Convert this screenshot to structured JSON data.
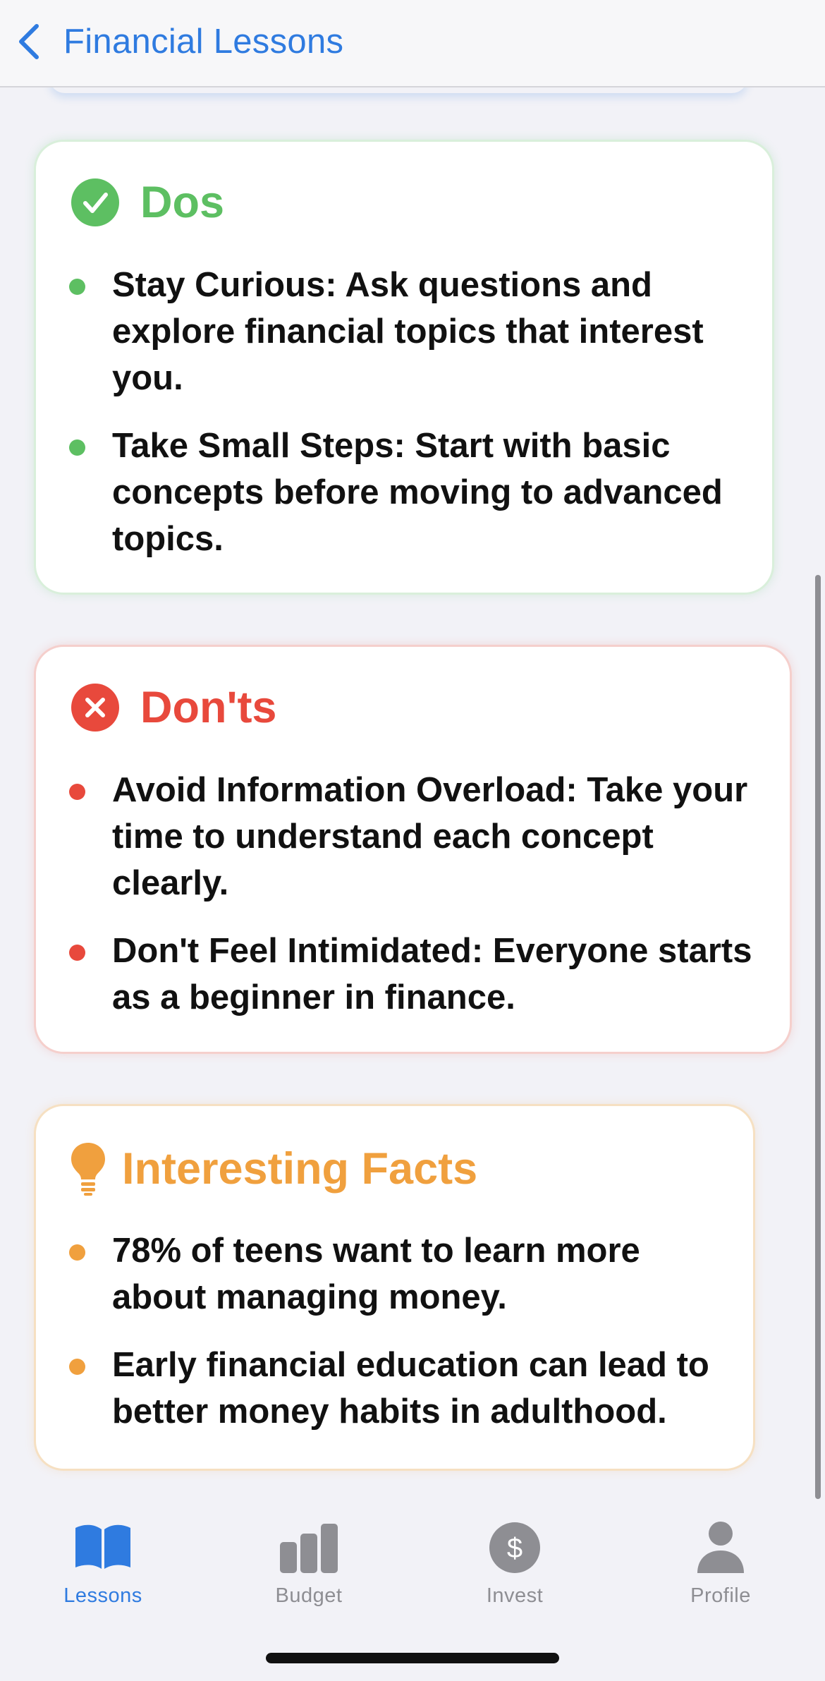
{
  "nav": {
    "title": "Financial Lessons",
    "back_icon": "chevron-left-icon"
  },
  "colors": {
    "accent": "#2f7be0",
    "dos": "#5dbf62",
    "donts": "#e8493c",
    "facts": "#f0a03e",
    "inactive_tab": "#8e8e93"
  },
  "sections": {
    "dos": {
      "title": "Dos",
      "icon": "checkmark-circle-icon",
      "items": [
        "Stay Curious: Ask questions and explore financial topics that interest you.",
        "Take Small Steps: Start with basic concepts before moving to advanced topics."
      ]
    },
    "donts": {
      "title": "Don'ts",
      "icon": "xmark-circle-icon",
      "items": [
        "Avoid Information Overload: Take your time to understand each concept clearly.",
        "Don't Feel Intimidated: Everyone starts as a beginner in finance."
      ]
    },
    "facts": {
      "title": "Interesting Facts",
      "icon": "lightbulb-icon",
      "items": [
        "78% of teens want to learn more about managing money.",
        "Early financial education can lead to better money habits in adulthood."
      ]
    }
  },
  "tabbar": {
    "selected": "Lessons",
    "tabs": [
      {
        "label": "Lessons",
        "icon": "book-icon"
      },
      {
        "label": "Budget",
        "icon": "bar-chart-icon"
      },
      {
        "label": "Invest",
        "icon": "dollar-circle-icon",
        "glyph": "$"
      },
      {
        "label": "Profile",
        "icon": "person-icon"
      }
    ]
  }
}
